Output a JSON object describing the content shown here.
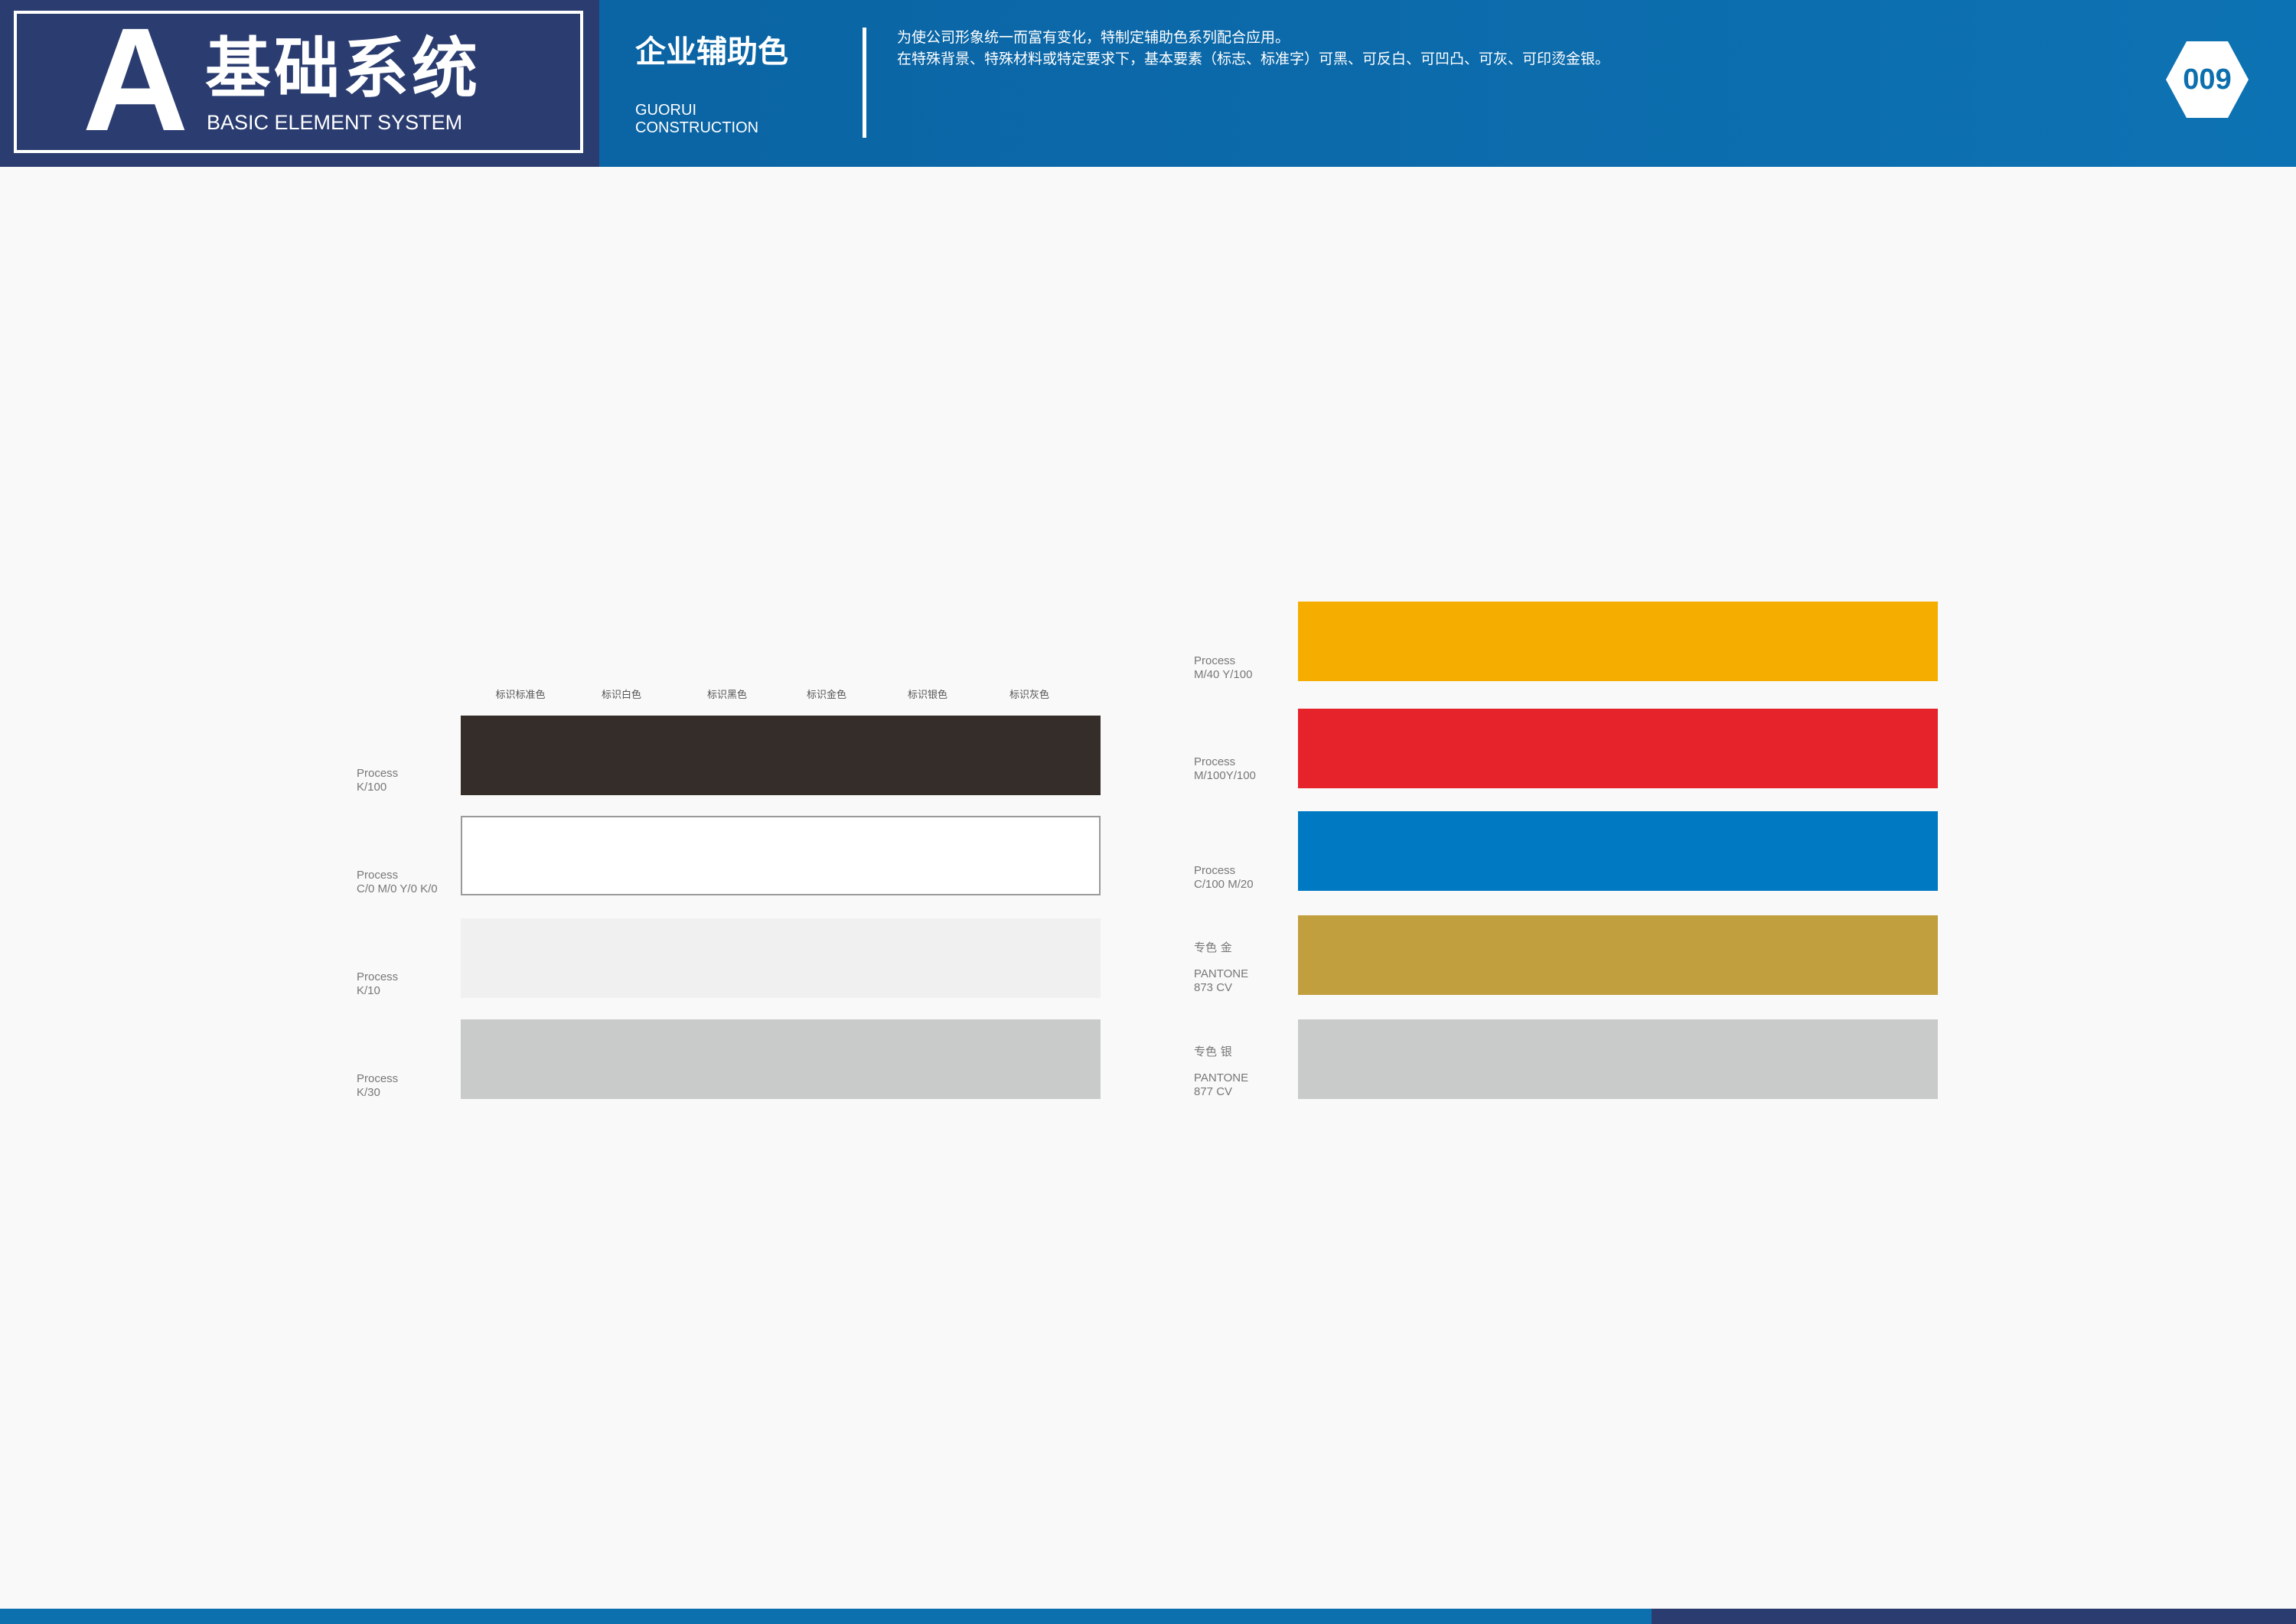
{
  "header": {
    "section_letter": "A",
    "section_title_cn": "基础系统",
    "section_title_en": "BASIC ELEMENT SYSTEM",
    "page_title": "企业辅助色",
    "company_line1": "GUORUI",
    "company_line2": "CONSTRUCTION",
    "description_line1": "为使公司形象统一而富有变化，特制定辅助色系列配合应用。",
    "description_line2": "在特殊背景、特殊材料或特定要求下，基本要素（标志、标准字）可黑、可反白、可凹凸、可灰、可印烫金银。",
    "page_number": "009"
  },
  "left_panel": {
    "column_labels": [
      "标识标准色",
      "标识白色",
      "标识黑色",
      "标识金色",
      "标识银色",
      "标识灰色"
    ],
    "swatches": [
      {
        "label": "Process\nK/100",
        "color": "#352d2a"
      },
      {
        "label": "Process\nC/0 M/0 Y/0 K/0",
        "color": "#ffffff"
      },
      {
        "label": "Process\nK/10",
        "color": "#f0f0f0"
      },
      {
        "label": "Process\nK/30",
        "color": "#c8cbca"
      }
    ]
  },
  "right_panel": {
    "swatches": [
      {
        "label": "Process\nM/40 Y/100",
        "color": "#f5ae00"
      },
      {
        "label": "Process\nM/100Y/100",
        "color": "#e6232b"
      },
      {
        "label": "Process\nC/100 M/20",
        "color": "#0079c3"
      },
      {
        "name": "专色 金",
        "label": "PANTONE\n873 CV",
        "color": "#c19e3e"
      },
      {
        "name": "专色 银",
        "label": "PANTONE\n877 CV",
        "color": "#c8cbca"
      }
    ]
  },
  "colors": {
    "header_dark": "#2b3d70",
    "header_blue": "#0d72b3",
    "background": "#f9f9f9"
  }
}
